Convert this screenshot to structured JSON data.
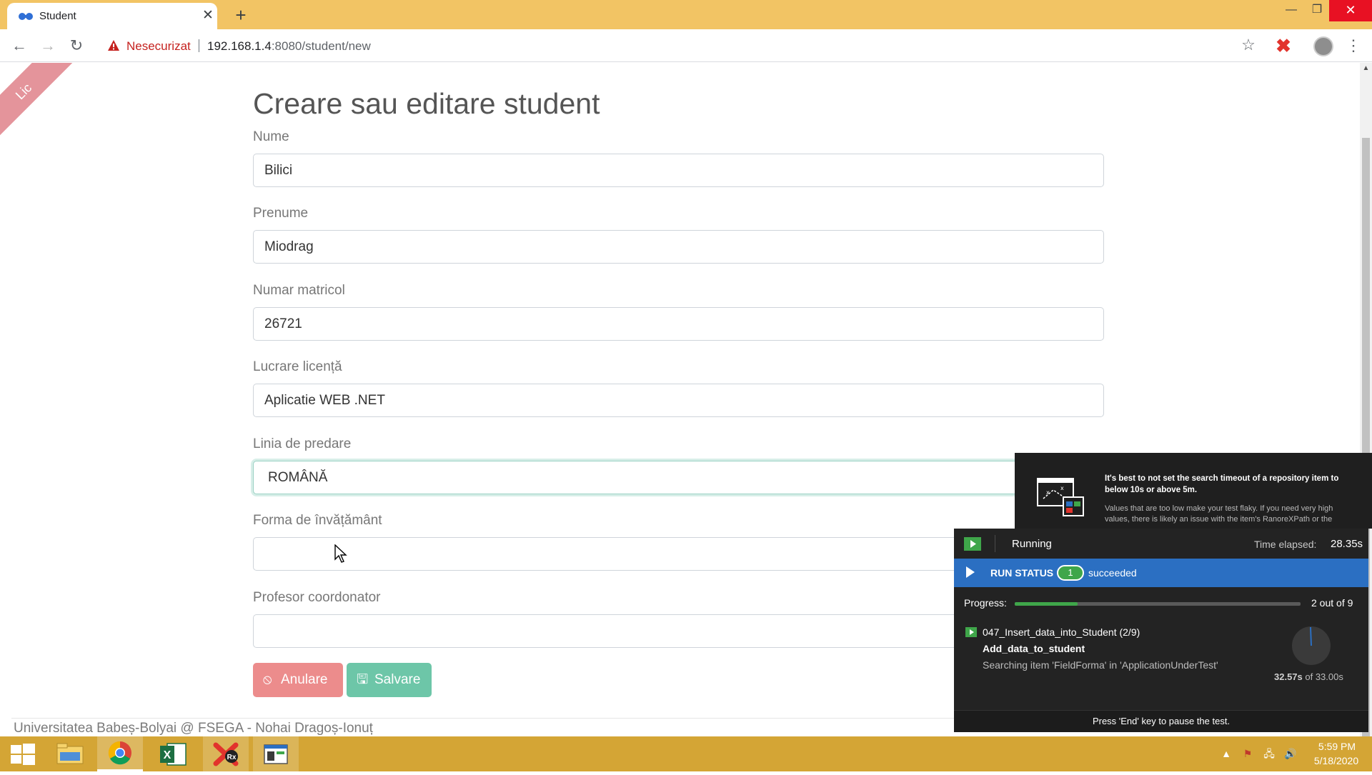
{
  "browser": {
    "tab_title": "Student",
    "tab_close_glyph": "✕",
    "new_tab_glyph": "+",
    "insecure_label": "Nesecurizat",
    "url_host": "192.168.1.4",
    "url_path": ":8080/student/new",
    "accent": "#f2c464"
  },
  "page": {
    "ribbon_text": "Lic",
    "title": "Creare sau editare student",
    "fields": [
      {
        "label": "Nume",
        "value": "Bilici"
      },
      {
        "label": "Prenume",
        "value": "Miodrag"
      },
      {
        "label": "Numar matricol",
        "value": "26721"
      },
      {
        "label": "Lucrare licență",
        "value": "Aplicatie WEB .NET"
      },
      {
        "label": "Linia de predare",
        "value": "ROMÂNĂ"
      },
      {
        "label": "Forma de învățământ",
        "value": ""
      },
      {
        "label": "Profesor coordonator",
        "value": ""
      }
    ],
    "buttons": {
      "cancel_label": "Anulare",
      "save_label": "Salvare",
      "cancel_color": "#ec8c8c",
      "save_color": "#6dc6a8"
    },
    "footer": "Universitatea Babeș-Bolyai @ FSEGA - Nohai Dragoș-Ionuț"
  },
  "ranorex": {
    "tip_title": "It's best to not set the search timeout of a repository item to below 10s or above 5m.",
    "tip_body": "Values that are too low make your test flaky. If you need very high values, there is likely an issue with the item's RanoreXPath or the",
    "state": "Running",
    "elapsed_label": "Time elapsed:",
    "elapsed_value": "28.35s",
    "run_status_label": "RUN STATUS",
    "succeeded_count": "1",
    "succeeded_label": "succeeded",
    "progress_label": "Progress:",
    "progress_fraction": 0.22,
    "progress_text": "2 out of 9",
    "suite": "047_Insert_data_into_Student (2/9)",
    "test_case": "Add_data_to_student",
    "action": "Searching item 'FieldForma' in 'ApplicationUnderTest'",
    "timing_current": "32.57s",
    "timing_rest": " of 33.00s",
    "footer": "Press 'End' key to pause the test.",
    "status_color": "#2b6fc2",
    "success_color": "#3fa64a"
  },
  "taskbar": {
    "time": "5:59 PM",
    "date": "5/18/2020",
    "color": "#d4a535"
  }
}
